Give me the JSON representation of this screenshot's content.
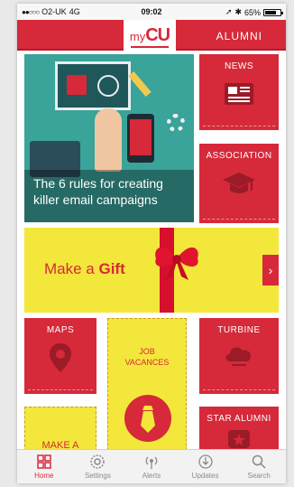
{
  "status_bar": {
    "carrier": "O2-UK",
    "network": "4G",
    "time": "09:02",
    "battery": "65%",
    "battery_level": 0.65
  },
  "header": {
    "logo_my": "my",
    "logo_cu": "CU",
    "alumni_label": "ALUMNI"
  },
  "hero": {
    "caption": "The 6 rules for creating killer email campaigns"
  },
  "tiles": {
    "news": "NEWS",
    "association": "ASSOCIATION",
    "gift_text_prefix": "Make a ",
    "gift_text_bold": "Gift",
    "gift_arrow": "›",
    "maps": "MAPS",
    "job": "JOB",
    "vacancies": "VACANCES",
    "turbine": "TURBINE",
    "make_a": "MAKE A",
    "star_alumni": "STAR ALUMNI"
  },
  "tabbar": {
    "items": [
      {
        "label": "Home",
        "icon": "home-grid-icon"
      },
      {
        "label": "Settings",
        "icon": "settings-icon"
      },
      {
        "label": "Alerts",
        "icon": "alerts-icon"
      },
      {
        "label": "Updates",
        "icon": "updates-icon"
      },
      {
        "label": "Search",
        "icon": "search-icon"
      }
    ]
  },
  "colors": {
    "brand_red": "#d6293a",
    "accent_yellow": "#f4e73b",
    "teal": "#3aa39a"
  }
}
